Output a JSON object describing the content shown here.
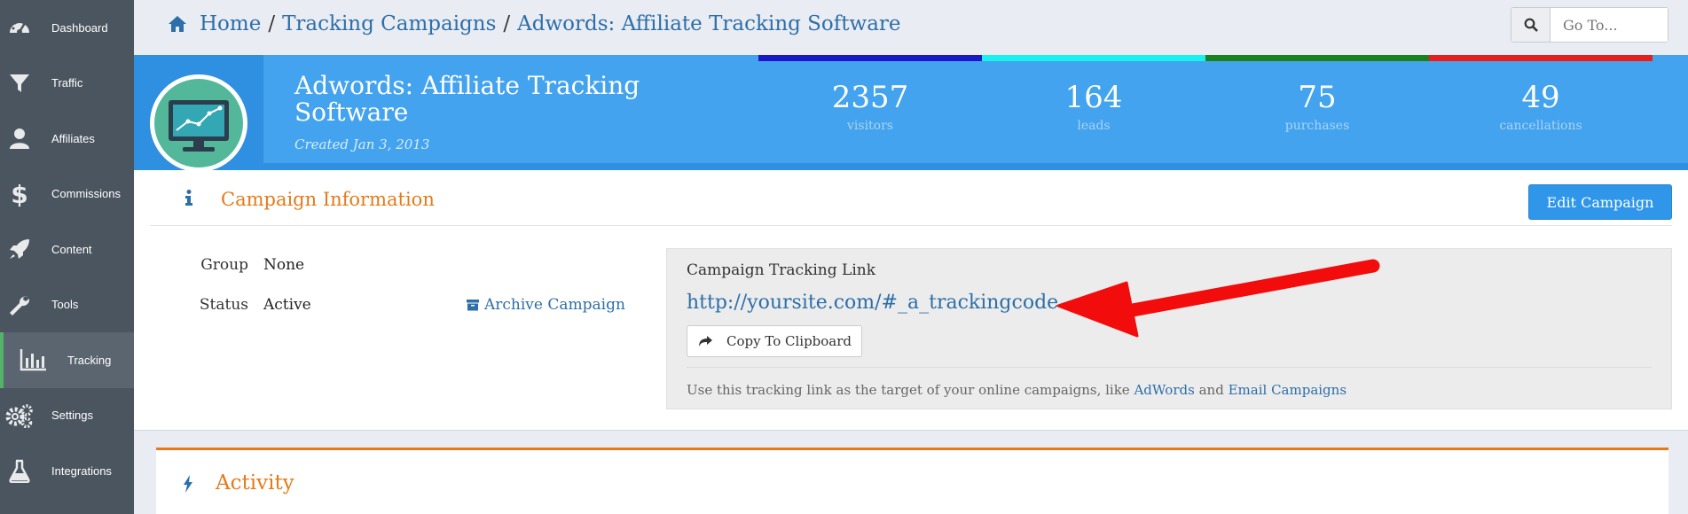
{
  "sidebar": {
    "items": [
      {
        "label": "Dashboard",
        "icon": "gauge-icon"
      },
      {
        "label": "Traffic",
        "icon": "funnel-icon"
      },
      {
        "label": "Affiliates",
        "icon": "user-icon"
      },
      {
        "label": "Commissions",
        "icon": "dollar-icon"
      },
      {
        "label": "Content",
        "icon": "rocket-icon"
      },
      {
        "label": "Tools",
        "icon": "wrench-icon"
      },
      {
        "label": "Tracking",
        "icon": "bar-chart-icon",
        "active": true
      },
      {
        "label": "Settings",
        "icon": "gears-icon"
      },
      {
        "label": "Integrations",
        "icon": "flask-icon"
      }
    ]
  },
  "breadcrumb": {
    "home": "Home",
    "section": "Tracking Campaigns",
    "current": "Adwords: Affiliate Tracking Software",
    "separator": "/"
  },
  "goto": {
    "placeholder": "Go To..."
  },
  "header": {
    "title": "Adwords: Affiliate Tracking Software",
    "created": "Created Jan 3, 2013",
    "stats": [
      {
        "value": "2357",
        "label": "visitors",
        "color": "#1919c8"
      },
      {
        "value": "164",
        "label": "leads",
        "color": "#19f0f0"
      },
      {
        "value": "75",
        "label": "purchases",
        "color": "#19821e"
      },
      {
        "value": "49",
        "label": "cancellations",
        "color": "#e61e1e"
      }
    ]
  },
  "campaign_info": {
    "title": "Campaign Information",
    "edit_label": "Edit Campaign",
    "group_label": "Group",
    "group_value": "None",
    "status_label": "Status",
    "status_value": "Active",
    "archive_label": "Archive Campaign",
    "tracking": {
      "label": "Campaign Tracking Link",
      "url": "http://yoursite.com/#_a_trackingcode",
      "copy_label": "Copy To Clipboard",
      "help_prefix": "Use this tracking link as the target of your online campaigns, like",
      "help_link1": "AdWords",
      "help_and": "and",
      "help_link2": "Email Campaigns"
    }
  },
  "activity": {
    "title": "Activity"
  },
  "colors": {
    "accent_orange": "#e67a19",
    "banner_blue": "#43a3ee",
    "sidebar": "#4b555f",
    "active_marker": "#53b36a"
  }
}
